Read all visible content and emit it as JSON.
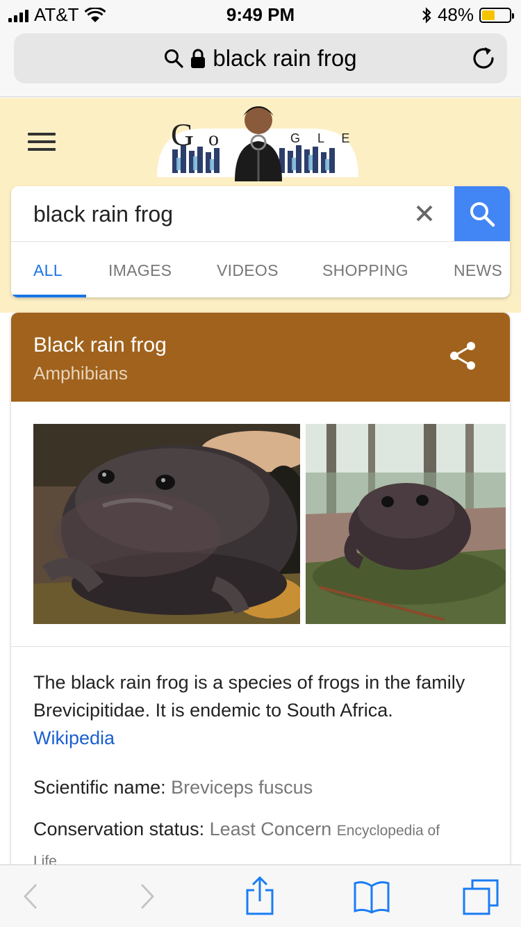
{
  "status_bar": {
    "carrier": "AT&T",
    "time": "9:49 PM",
    "battery_pct": "48%",
    "battery_level": 0.48,
    "icons": [
      "signal-icon",
      "wifi-icon",
      "bluetooth-icon",
      "battery-icon"
    ]
  },
  "url_bar": {
    "text": "black rain frog",
    "icons": [
      "search-icon",
      "lock-icon",
      "reload-icon"
    ]
  },
  "google": {
    "doodle_letters": "G o g l e"
  },
  "search": {
    "query": "black rain frog",
    "tabs": [
      {
        "label": "ALL",
        "active": true
      },
      {
        "label": "IMAGES",
        "active": false
      },
      {
        "label": "VIDEOS",
        "active": false
      },
      {
        "label": "SHOPPING",
        "active": false
      },
      {
        "label": "NEWS",
        "active": false
      }
    ],
    "accent": "#4285f4",
    "tab_active_color": "#1a73e8"
  },
  "knowledge": {
    "title": "Black rain frog",
    "subtitle": "Amphibians",
    "header_color": "#a0621c",
    "description": "The black rain frog is a species of frogs in the family Brevicipitidae. It is endemic to South Africa.",
    "source_link": "Wikipedia",
    "scientific_label": "Scientific name:",
    "scientific_value": "Breviceps fuscus",
    "conservation_label": "Conservation status:",
    "conservation_value": "Least Concern",
    "conservation_source": "Encyclopedia of",
    "conservation_source_cont": "Life"
  },
  "toolbar": {
    "icons": [
      "back-icon",
      "forward-icon",
      "share-icon",
      "bookmarks-icon",
      "tabs-icon"
    ],
    "tint": "#1a7cf5"
  }
}
